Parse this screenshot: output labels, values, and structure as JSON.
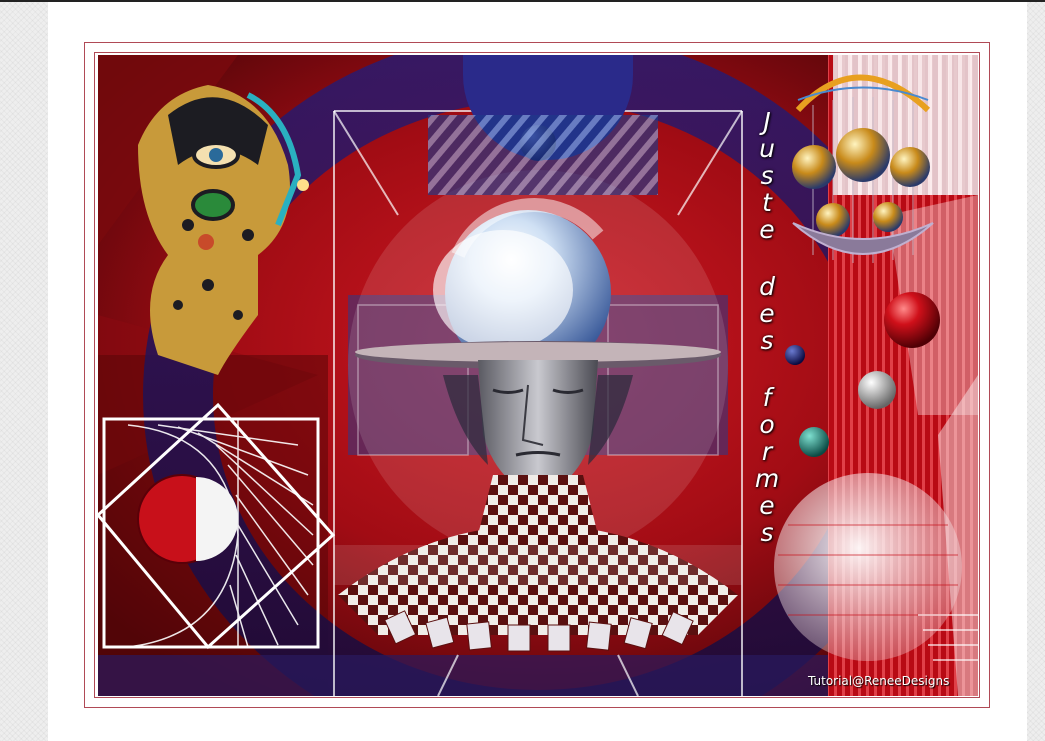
{
  "artwork": {
    "title_text": "Juste des formes",
    "signature": "Tutorial@ReneeDesigns"
  },
  "colors": {
    "frame_border": "#b04a56",
    "art_red": "#b8101a",
    "art_navy": "#2a1a6a",
    "page_bg": "#ffffff"
  }
}
